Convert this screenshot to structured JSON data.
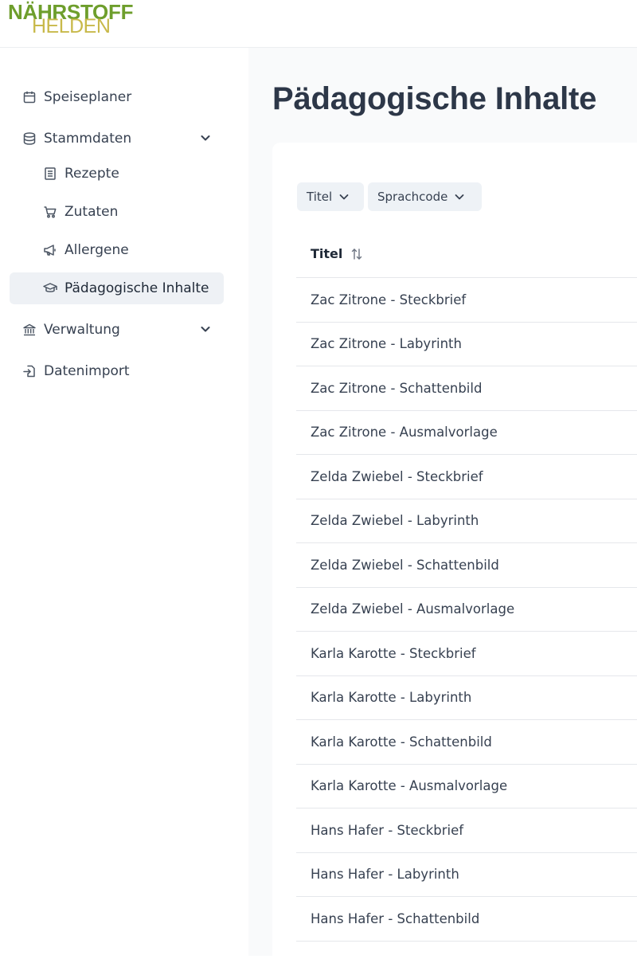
{
  "brand": {
    "line1": "NÄHRSTOFF",
    "line2": "HELDEN",
    "color_primary": "#6e9e2c",
    "color_secondary": "#c8b94a"
  },
  "sidebar": {
    "items": [
      {
        "label": "Speiseplaner",
        "icon": "calendar-icon"
      },
      {
        "label": "Stammdaten",
        "icon": "database-icon",
        "expanded": true
      },
      {
        "label": "Rezepte",
        "icon": "book-icon"
      },
      {
        "label": "Zutaten",
        "icon": "cart-icon"
      },
      {
        "label": "Allergene",
        "icon": "megaphone-icon"
      },
      {
        "label": "Pädagogische Inhalte",
        "icon": "graduation-cap-icon",
        "active": true
      },
      {
        "label": "Verwaltung",
        "icon": "bank-icon"
      },
      {
        "label": "Datenimport",
        "icon": "import-icon"
      }
    ],
    "active_bg": "#eef1f5"
  },
  "main": {
    "title": "Pädagogische Inhalte",
    "filters": [
      {
        "label": "Titel"
      },
      {
        "label": "Sprachcode"
      }
    ],
    "table": {
      "header": "Titel",
      "rows": [
        "Zac Zitrone - Steckbrief",
        "Zac Zitrone - Labyrinth",
        "Zac Zitrone - Schattenbild",
        "Zac Zitrone - Ausmalvorlage",
        "Zelda Zwiebel - Steckbrief",
        "Zelda Zwiebel - Labyrinth",
        "Zelda Zwiebel - Schattenbild",
        "Zelda Zwiebel - Ausmalvorlage",
        "Karla Karotte - Steckbrief",
        "Karla Karotte - Labyrinth",
        "Karla Karotte - Schattenbild",
        "Karla Karotte - Ausmalvorlage",
        "Hans Hafer - Steckbrief",
        "Hans Hafer - Labyrinth",
        "Hans Hafer - Schattenbild"
      ]
    }
  }
}
